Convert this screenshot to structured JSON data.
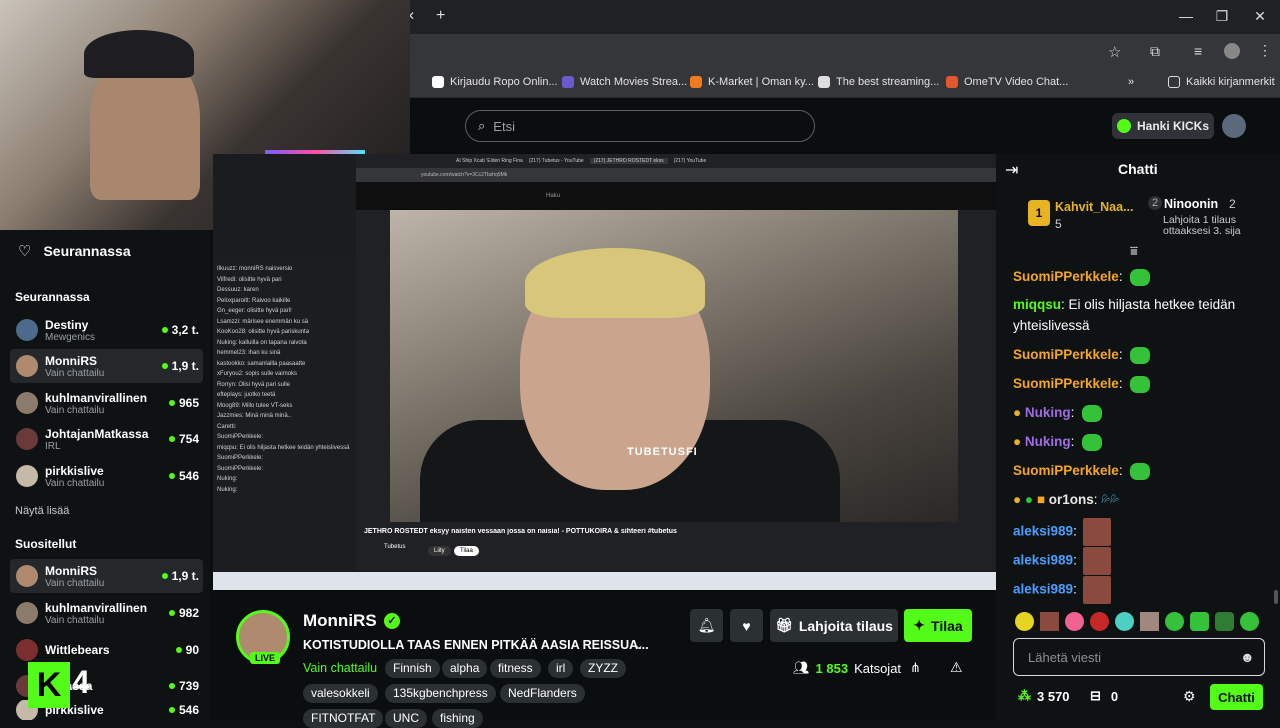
{
  "browser": {
    "search_placeholder": "Etsi",
    "bookmarks": [
      "Kirjaudu Ropo Onlin...",
      "Watch Movies Strea...",
      "K-Market | Oman ky...",
      "The best streaming...",
      "OmeTV Video Chat..."
    ],
    "bookmarks_more": "»",
    "all_bookmarks": "Kaikki kirjanmerkit",
    "new_tab": "+"
  },
  "topnav": {
    "kicks_label": "Hanki KICKs"
  },
  "sidebar": {
    "following_heading": "Seurannassa",
    "following_section": "Seurannassa",
    "following": [
      {
        "name": "Destiny",
        "sub": "Mewgenics",
        "viewers": "3,2 t.",
        "color": "#4b6a8c"
      },
      {
        "name": "MonniRS",
        "sub": "Vain chattailu",
        "viewers": "1,9 t.",
        "color": "#b08a6e"
      },
      {
        "name": "kuhlmanvirallinen",
        "sub": "Vain chattailu",
        "viewers": "965",
        "color": "#8c7b6a"
      },
      {
        "name": "JohtajanMatkassa",
        "sub": "IRL",
        "viewers": "754",
        "color": "#6a3a3a"
      },
      {
        "name": "pirkkislive",
        "sub": "Vain chattailu",
        "viewers": "546",
        "color": "#c5b9a8"
      }
    ],
    "show_more": "Näytä lisää",
    "recommended_heading": "Suositellut",
    "recommended": [
      {
        "name": "MonniRS",
        "sub": "Vain chattailu",
        "viewers": "1,9 t.",
        "color": "#b08a6e"
      },
      {
        "name": "kuhlmanvirallinen",
        "sub": "Vain chattailu",
        "viewers": "982",
        "color": "#8c7b6a"
      },
      {
        "name": "Wittlebears",
        "sub": "",
        "viewers": "90",
        "color": "#7a2e2e"
      },
      {
        "name": "...tkassa",
        "sub": "",
        "viewers": "739",
        "color": "#6a3a3a"
      },
      {
        "name": "pirkkislive",
        "sub": "",
        "viewers": "546",
        "color": "#c5b9a8"
      }
    ]
  },
  "video": {
    "inner_tabs": [
      "AI Ship Xcab 'Elden Ring Fina",
      "(217) Tubetus - YouTube",
      "(217) JETHRO ROSTEDT ekss",
      "(217) YouTube"
    ],
    "url": "youtube.com/watch?v=3Cc2Tbshq9Mk",
    "yt_search": "Haku",
    "watermark": "TUBETUSFI",
    "video_title": "JETHRO ROSTEDT eksyy naisten vessaan jossa on naisia! - POTTUKOIRA & sihteeri #tubetus",
    "channel": "Tubetus",
    "join": "Liity",
    "subscribe": "Tilaa",
    "inner_chat_lines": [
      "Ilkuuzz: monniRS naisversio",
      "Vilfredi: olisitte hyvä pari",
      "Dessuuz: karen",
      "Peloxparoitt: Raivoo kaikille",
      "Gn_eeger: olisitte hyvä pari!",
      "Lsamzzi: märisee enemmän ku sä",
      "KooKoo28: olisitte hyvä pariskunta",
      "Nuking: kalluilla on tapana raivota",
      "hemmel23: ihan ku sinä",
      "kastookko: samanlailla paasaatte",
      "xFuryou2: sopis sulle vaimoks",
      "Rorryn: Olisi hyvä pari sulle",
      "efteplays: juotko teetä",
      "Moog89: Millo tulee VT-seks",
      "Jazzmies: Minä minä minä..",
      "Caretti:",
      "SuomiPPerkkele:",
      "miqqsu: Ei olis hiljasta hetkee teidän yhteislivessä",
      "SuomiPPerkkele:",
      "SuomiPPerkkele:",
      "Nuking:",
      "Nuking:"
    ]
  },
  "stream": {
    "streamer": "MonniRS",
    "live_badge": "LIVE",
    "title": "KOTISTUDIOLLA TAAS ENNEN PITKÄÄ AASIA REISSUA...",
    "category": "Vain chattailu",
    "tags": [
      "Finnish",
      "alpha",
      "fitness",
      "irl",
      "ZYZZ",
      "valesokkeli",
      "135kgbenchpress",
      "NedFlanders",
      "FITNOTFAT",
      "UNC",
      "fishing"
    ],
    "gift_button": "Lahjoita tilaus",
    "subscribe_button": "Tilaa",
    "viewers": "1 853",
    "viewers_label": "Katsojat"
  },
  "chat": {
    "title": "Chatti",
    "top_gifters": [
      {
        "rank": "1",
        "name": "Kahvit_Naa...",
        "count": "5"
      },
      {
        "rank": "2",
        "name": "Ninoonin",
        "count": "2"
      }
    ],
    "promo": "Lahjoita 1 tilaus ottaaksesi 3. sija",
    "messages": [
      {
        "user": "SuomiPPerkkele",
        "color": "#f5a623",
        "text": ""
      },
      {
        "user": "miqqsu",
        "color": "#53fc18",
        "text": "Ei olis hiljasta hetkee teidän yhteislivessä"
      },
      {
        "user": "SuomiPPerkkele",
        "color": "#f5a623",
        "text": ""
      },
      {
        "user": "SuomiPPerkkele",
        "color": "#f5a623",
        "text": ""
      },
      {
        "user": "Nuking",
        "color": "#a06ce4",
        "text": ""
      },
      {
        "user": "Nuking",
        "color": "#a06ce4",
        "text": ""
      },
      {
        "user": "SuomiPPerkkele",
        "color": "#f5a623",
        "text": ""
      },
      {
        "user": "or1ons",
        "color": "#e8e8e8",
        "text": ""
      },
      {
        "user": "aleksi989",
        "color": "#4a9eff",
        "text": ""
      },
      {
        "user": "aleksi989",
        "color": "#4a9eff",
        "text": ""
      },
      {
        "user": "aleksi989",
        "color": "#4a9eff",
        "text": ""
      }
    ],
    "input_placeholder": "Lähetä viesti",
    "points": "3 570",
    "gifts": "0",
    "send_button": "Chatti"
  },
  "overlay": {
    "badge_number": "4"
  },
  "colors": {
    "accent": "#53fc18",
    "background": "#0b0e0f"
  }
}
